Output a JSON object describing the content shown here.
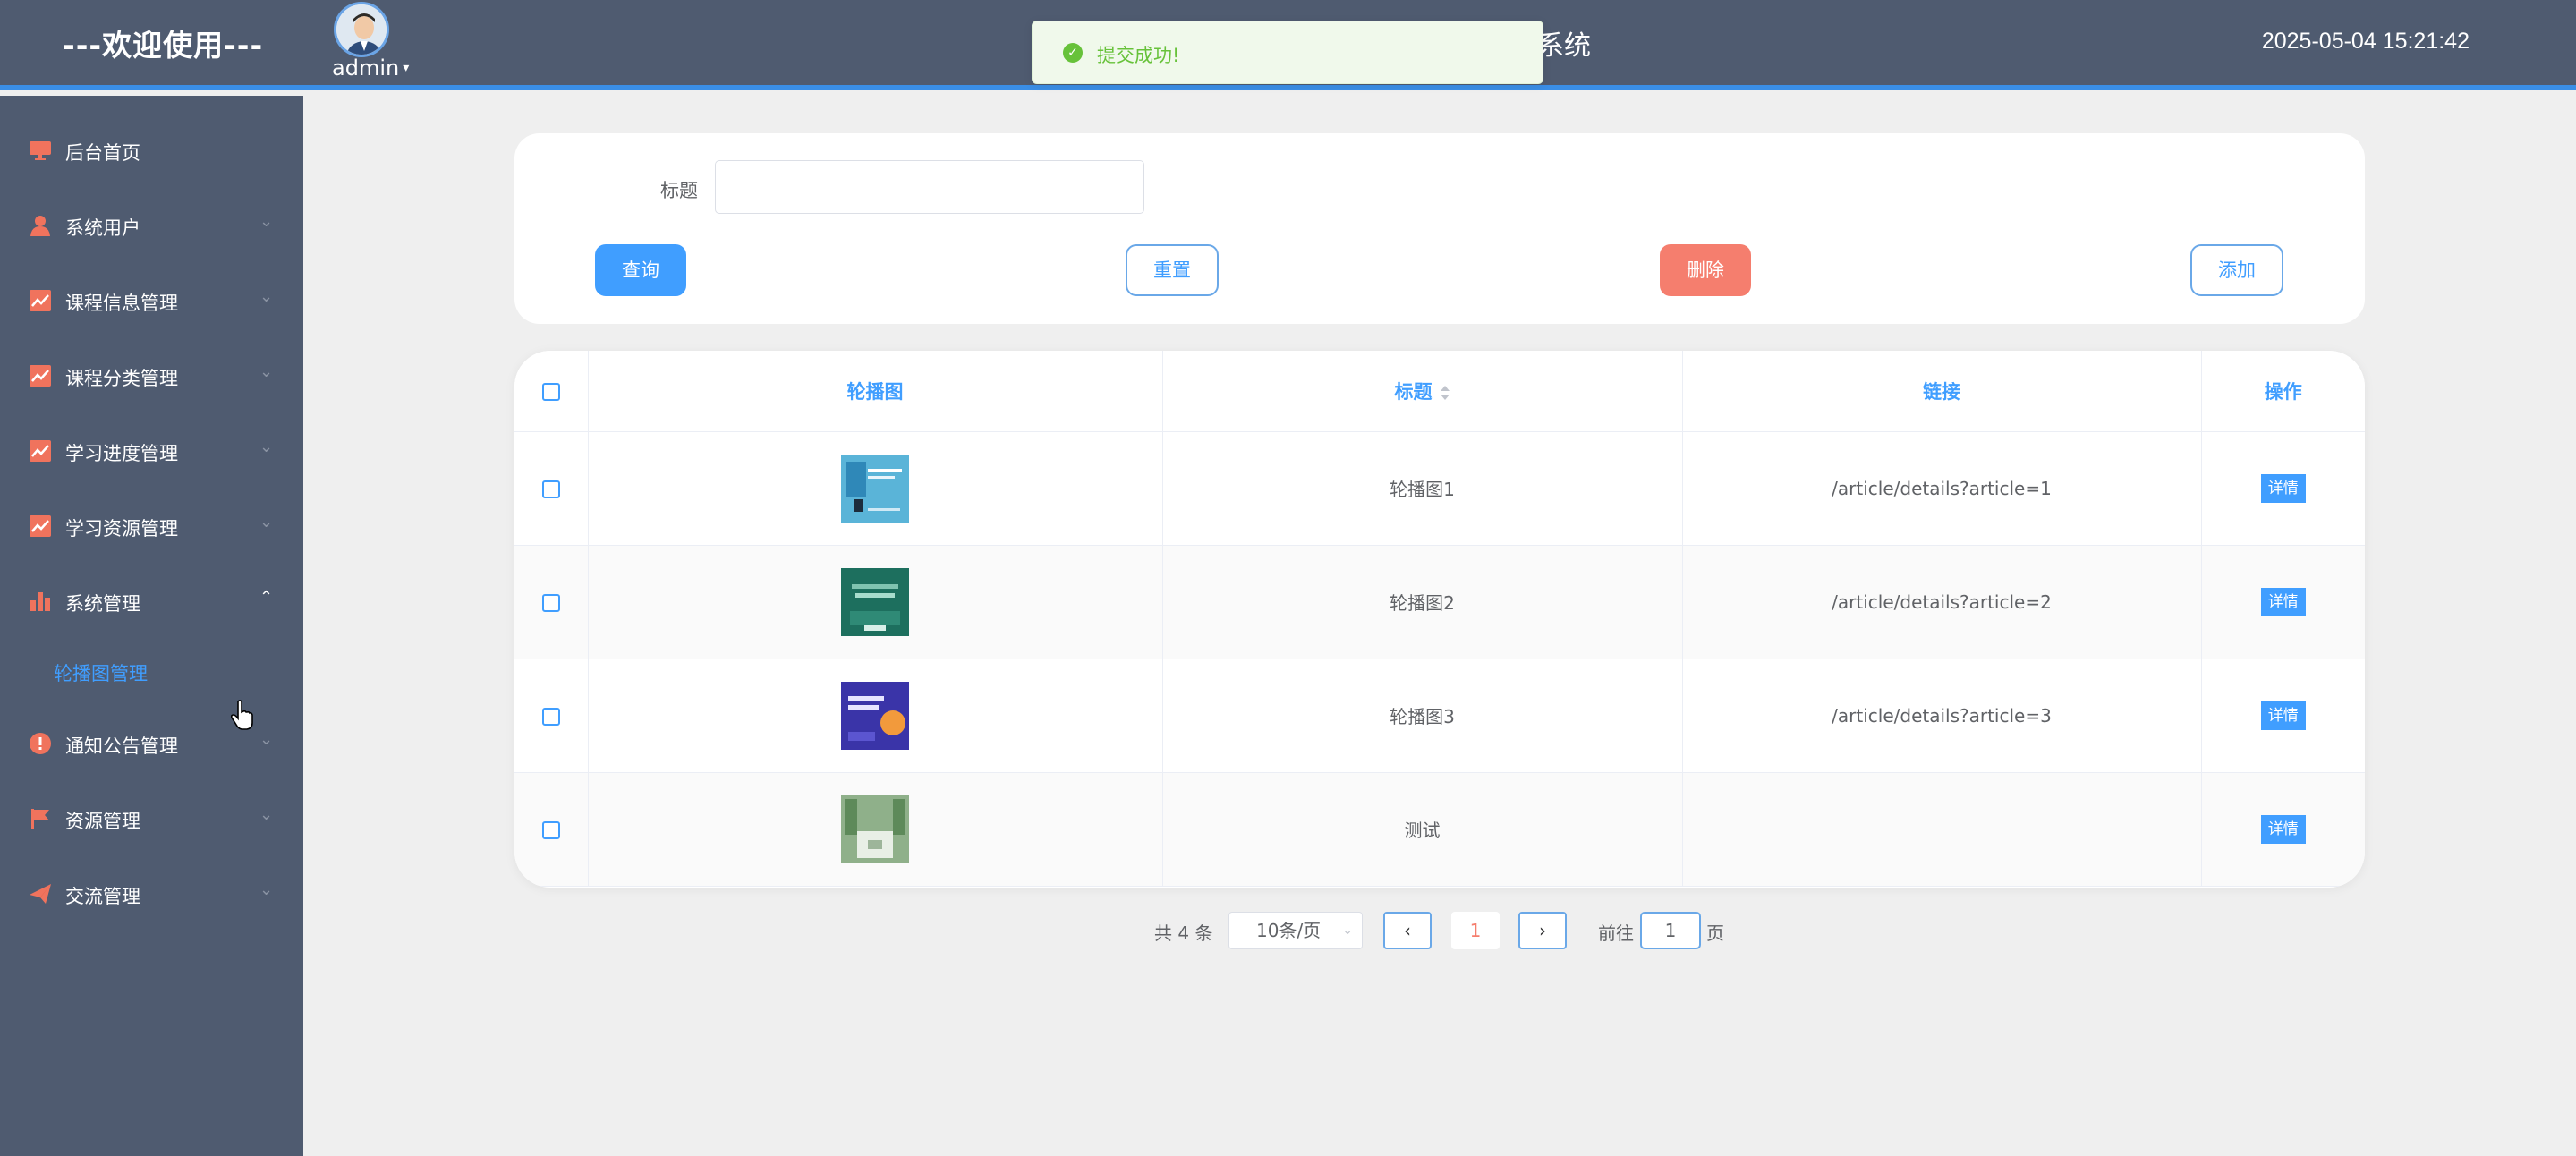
{
  "header": {
    "welcome": "---欢迎使用---",
    "user": "admin",
    "system_title_fragment": "系统",
    "datetime": "2025-05-04 15:21:42"
  },
  "toast": {
    "message": "提交成功!",
    "type": "success"
  },
  "sidebar": {
    "items": [
      {
        "label": "后台首页",
        "icon": "monitor-icon"
      },
      {
        "label": "系统用户",
        "icon": "user-icon"
      },
      {
        "label": "课程信息管理",
        "icon": "chart-line-icon"
      },
      {
        "label": "课程分类管理",
        "icon": "chart-line-icon"
      },
      {
        "label": "学习进度管理",
        "icon": "chart-line-icon"
      },
      {
        "label": "学习资源管理",
        "icon": "chart-line-icon"
      },
      {
        "label": "系统管理",
        "icon": "bar-chart-icon",
        "expanded": true
      },
      {
        "label": "通知公告管理",
        "icon": "info-icon"
      },
      {
        "label": "资源管理",
        "icon": "flag-icon"
      },
      {
        "label": "交流管理",
        "icon": "send-icon"
      }
    ],
    "active_sub": "轮播图管理"
  },
  "search": {
    "title_label": "标题",
    "title_value": "",
    "query_label": "查询",
    "reset_label": "重置",
    "delete_label": "删除",
    "add_label": "添加"
  },
  "table": {
    "columns": [
      "轮播图",
      "标题",
      "链接",
      "操作"
    ],
    "rows": [
      {
        "title": "轮播图1",
        "link": "/article/details?article=1",
        "action": "详情"
      },
      {
        "title": "轮播图2",
        "link": "/article/details?article=2",
        "action": "详情"
      },
      {
        "title": "轮播图3",
        "link": "/article/details?article=3",
        "action": "详情"
      },
      {
        "title": "测试",
        "link": "",
        "action": "详情"
      }
    ]
  },
  "pagination": {
    "total_text": "共 4 条",
    "page_size": "10条/页",
    "current_page": "1",
    "goto_label": "前往",
    "goto_value": "1",
    "page_suffix": "页"
  },
  "colors": {
    "header_bg": "#4f5b70",
    "accent": "#409eff",
    "danger": "#f57e6e",
    "icon": "#f0735d",
    "success": "#67c23a"
  }
}
